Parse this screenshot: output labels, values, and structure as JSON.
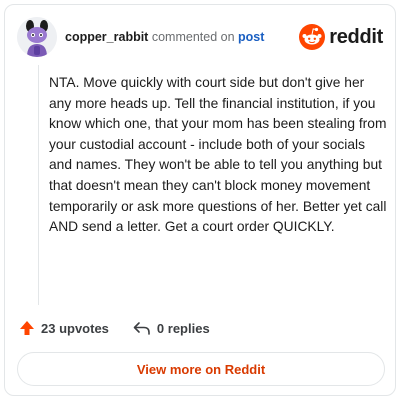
{
  "header": {
    "username": "copper_rabbit",
    "action_text": "commented on",
    "target_text": "post",
    "brand_name": "reddit"
  },
  "comment": {
    "text": "NTA. Move quickly with court side but don't give her any more heads up. Tell the financial institution, if you know which one, that your mom has been stealing from your custodial account - include both of your socials and names. They won't be able to tell you anything but that doesn't mean they can't block money movement temporarily or ask more questions of her. Better yet call AND send a letter. Get a court order QUICKLY."
  },
  "stats": {
    "upvotes_label": "23 upvotes",
    "replies_label": "0 replies"
  },
  "cta": {
    "label": "View more on Reddit"
  },
  "icons": {
    "avatar": "snoo-avatar-icon",
    "brand": "reddit-logo-icon",
    "upvote": "upvote-arrow-icon",
    "reply": "reply-arrow-icon"
  },
  "colors": {
    "brand_orange": "#ff4500",
    "link_blue": "#1a5fc2",
    "cta_text": "#d93a00",
    "avatar_purple": "#7b5bb6"
  }
}
